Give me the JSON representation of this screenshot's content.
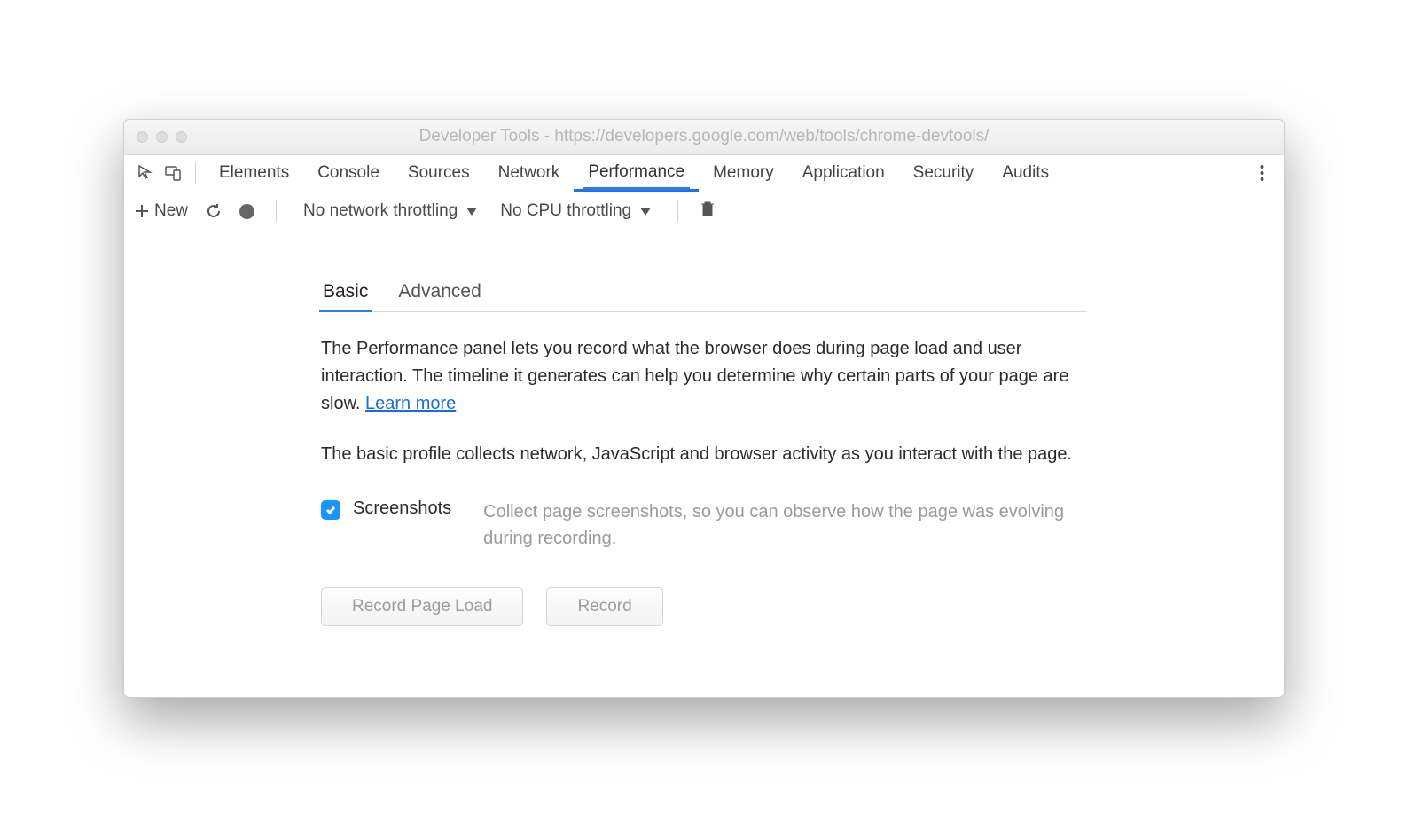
{
  "window": {
    "title": "Developer Tools - https://developers.google.com/web/tools/chrome-devtools/"
  },
  "tabs": {
    "items": [
      "Elements",
      "Console",
      "Sources",
      "Network",
      "Performance",
      "Memory",
      "Application",
      "Security",
      "Audits"
    ],
    "active": "Performance"
  },
  "toolbar": {
    "new_label": "New",
    "network_throttle": "No network throttling",
    "cpu_throttle": "No CPU throttling"
  },
  "subtabs": {
    "items": [
      "Basic",
      "Advanced"
    ],
    "active": "Basic"
  },
  "body": {
    "para1a": "The Performance panel lets you record what the browser does during page load and user interaction. The timeline it generates can help you determine why certain parts of your page are slow.  ",
    "learn_more": "Learn more",
    "para2": "The basic profile collects network, JavaScript and browser activity as you interact with the page.",
    "option": {
      "label": "Screenshots",
      "desc": "Collect page screenshots, so you can observe how the page was evolving during recording."
    },
    "buttons": {
      "record_page_load": "Record Page Load",
      "record": "Record"
    }
  }
}
